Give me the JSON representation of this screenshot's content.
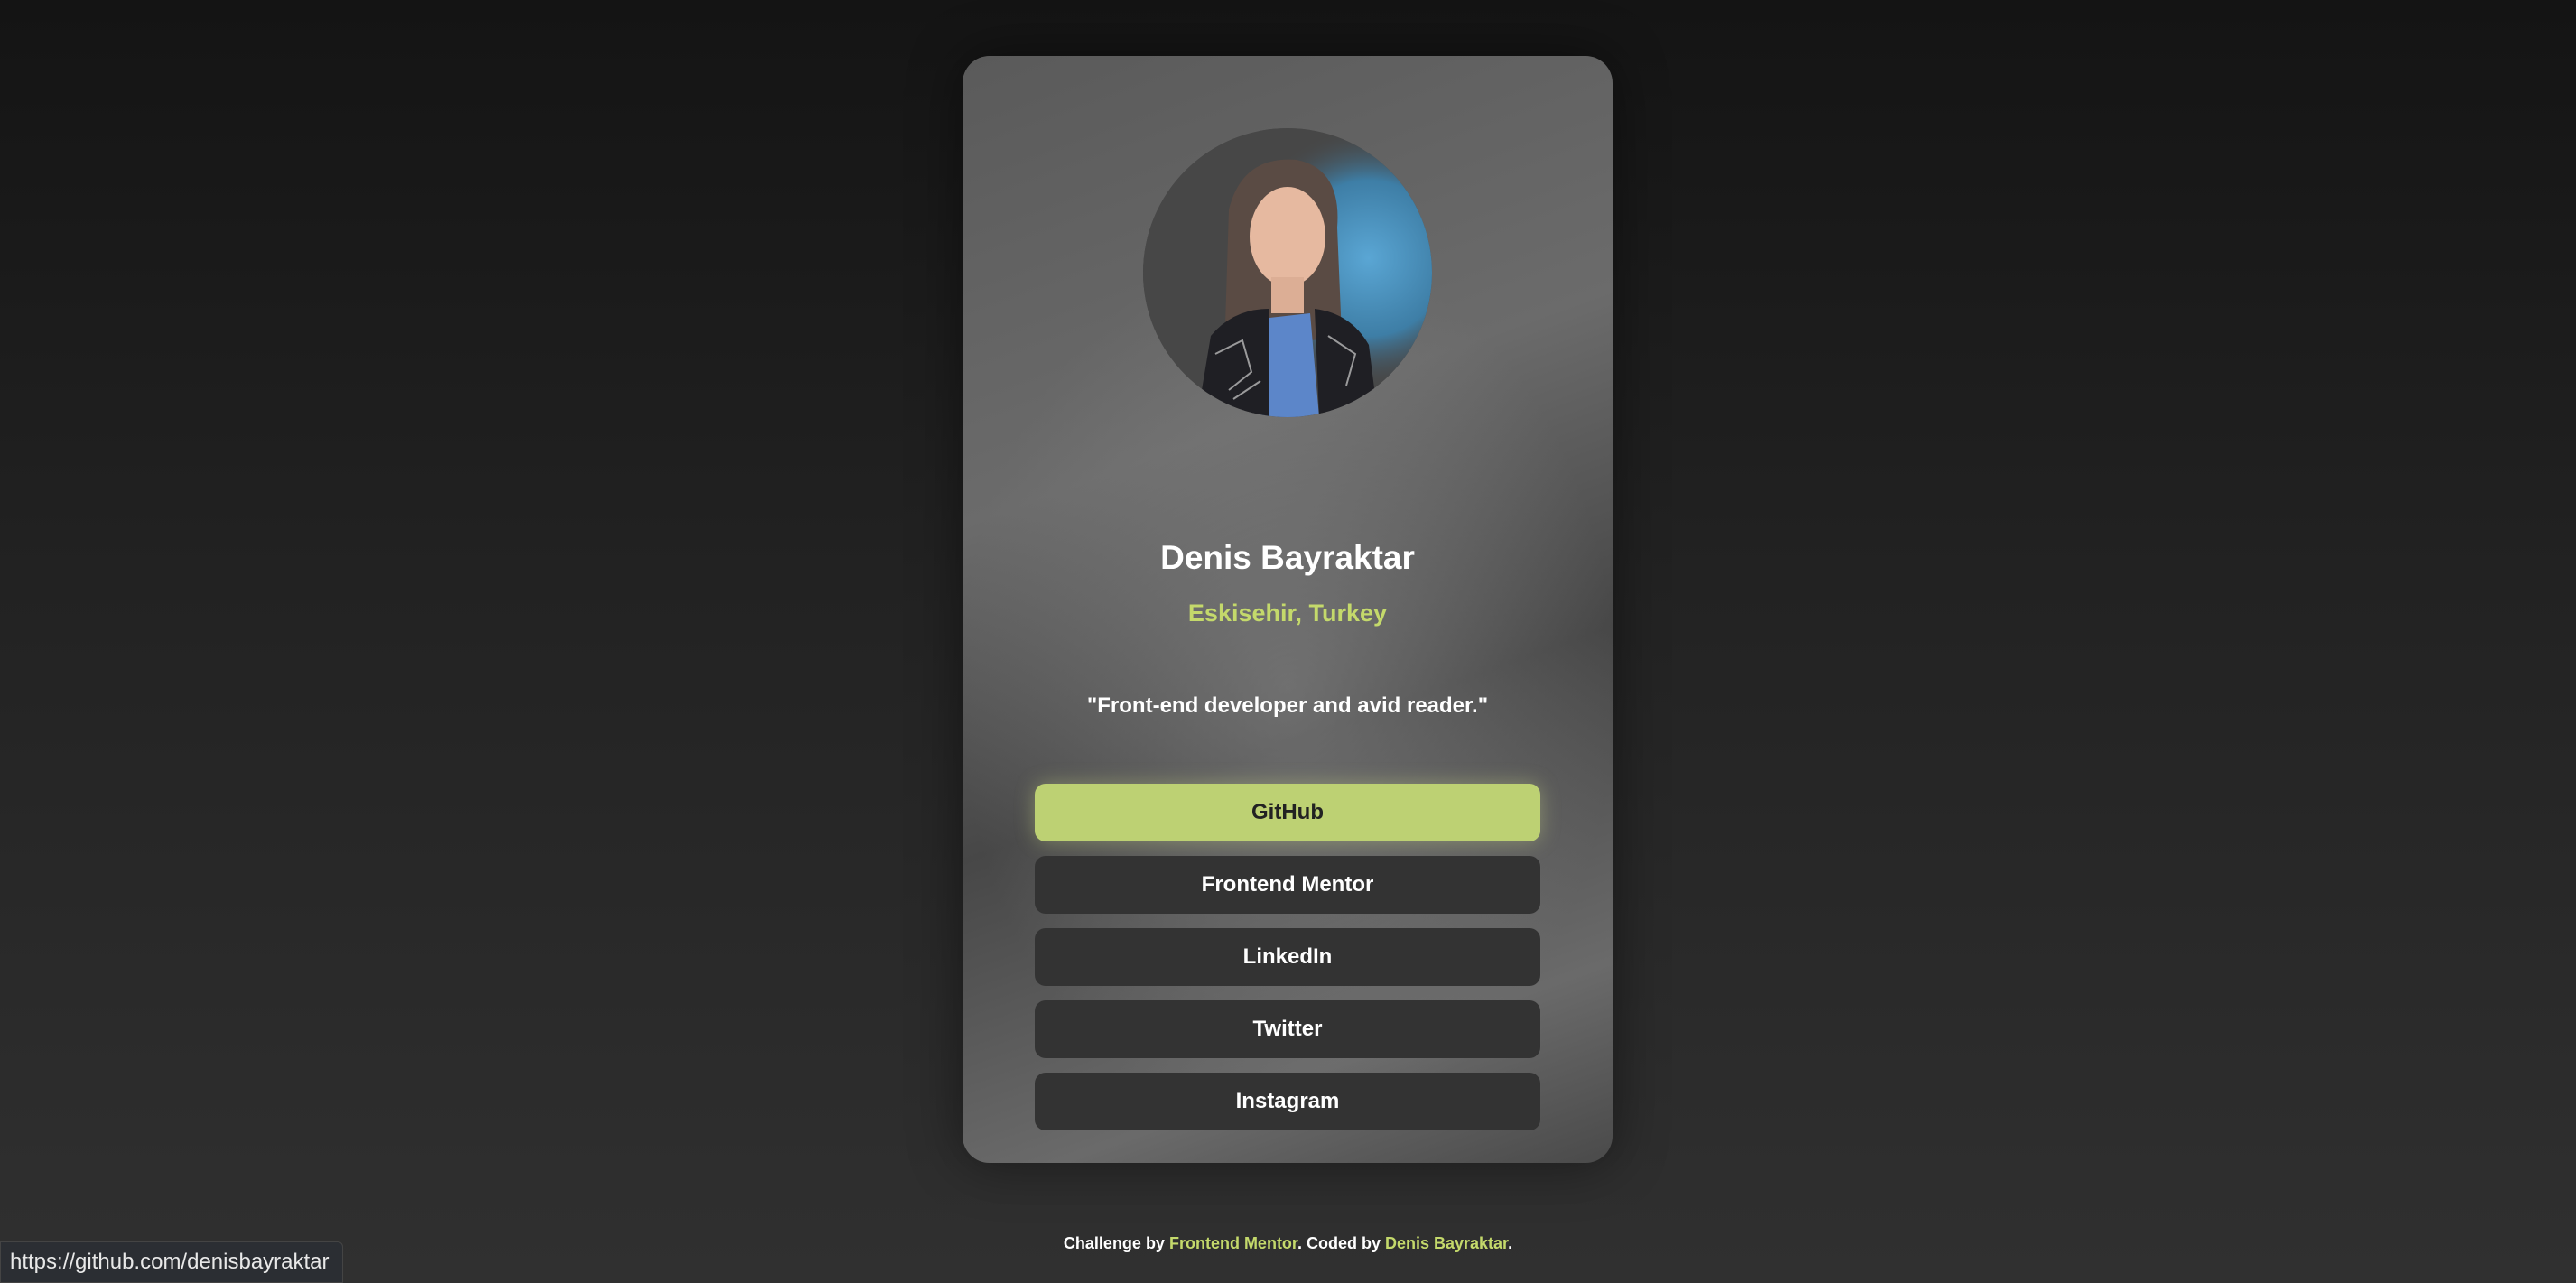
{
  "profile": {
    "name": "Denis Bayraktar",
    "location": "Eskisehir, Turkey",
    "bio": "\"Front-end developer and avid reader.\""
  },
  "links": [
    {
      "label": "GitHub",
      "active": true
    },
    {
      "label": "Frontend Mentor",
      "active": false
    },
    {
      "label": "LinkedIn",
      "active": false
    },
    {
      "label": "Twitter",
      "active": false
    },
    {
      "label": "Instagram",
      "active": false
    }
  ],
  "footer": {
    "prefix": "Challenge by ",
    "challenge_link": "Frontend Mentor",
    "middle": ". Coded by ",
    "author_link": "Denis Bayraktar",
    "suffix": "."
  },
  "status_bar": {
    "url": "https://github.com/denisbayraktar"
  },
  "colors": {
    "accent": "#c4d96b",
    "button_active": "#bdd173",
    "button": "#333333"
  }
}
